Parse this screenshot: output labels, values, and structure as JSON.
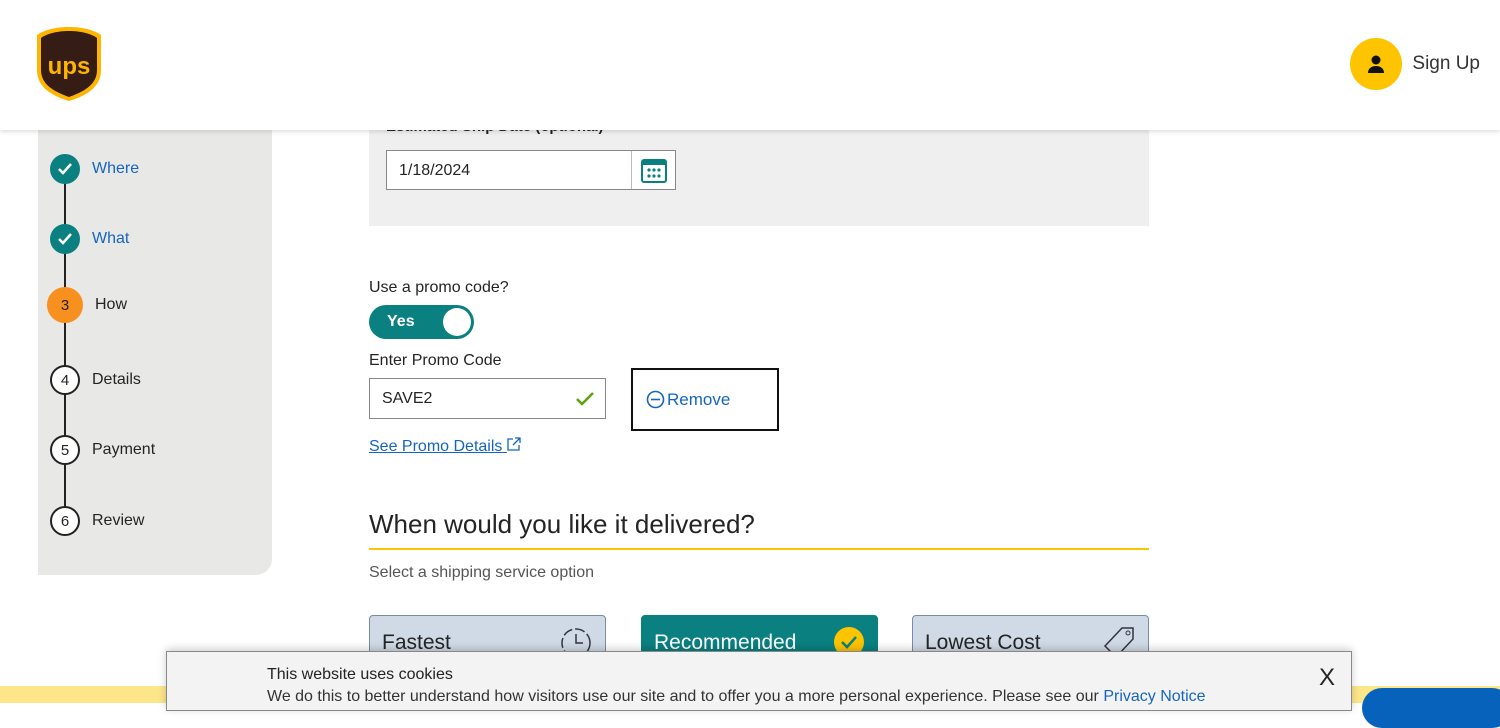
{
  "header": {
    "brand": "ups",
    "signup": "Sign Up"
  },
  "steps": [
    {
      "label": "Where",
      "status": "done"
    },
    {
      "label": "What",
      "status": "done"
    },
    {
      "num": "3",
      "label": "How",
      "status": "current"
    },
    {
      "num": "4",
      "label": "Details"
    },
    {
      "num": "5",
      "label": "Payment"
    },
    {
      "num": "6",
      "label": "Review"
    }
  ],
  "ship_date": {
    "label": "Estimated Ship Date (optional)",
    "value": "1/18/2024"
  },
  "promo": {
    "question": "Use a promo code?",
    "toggle": "Yes",
    "field_label": "Enter Promo Code",
    "value": "SAVE2",
    "remove": "Remove",
    "details_link": "See Promo Details"
  },
  "delivery": {
    "title": "When would you like it delivered?",
    "subtitle": "Select a shipping service option",
    "options": [
      "Fastest",
      "Recommended",
      "Lowest Cost"
    ]
  },
  "cookie": {
    "title": "This website uses cookies",
    "text": "We do this to better understand how visitors use our site and to offer you a more personal experience. Please see our ",
    "link": "Privacy Notice",
    "close": "X"
  },
  "colors": {
    "teal": "#0a8080",
    "gold": "#ffc400",
    "orange": "#f7901e",
    "link": "#1565c0"
  }
}
